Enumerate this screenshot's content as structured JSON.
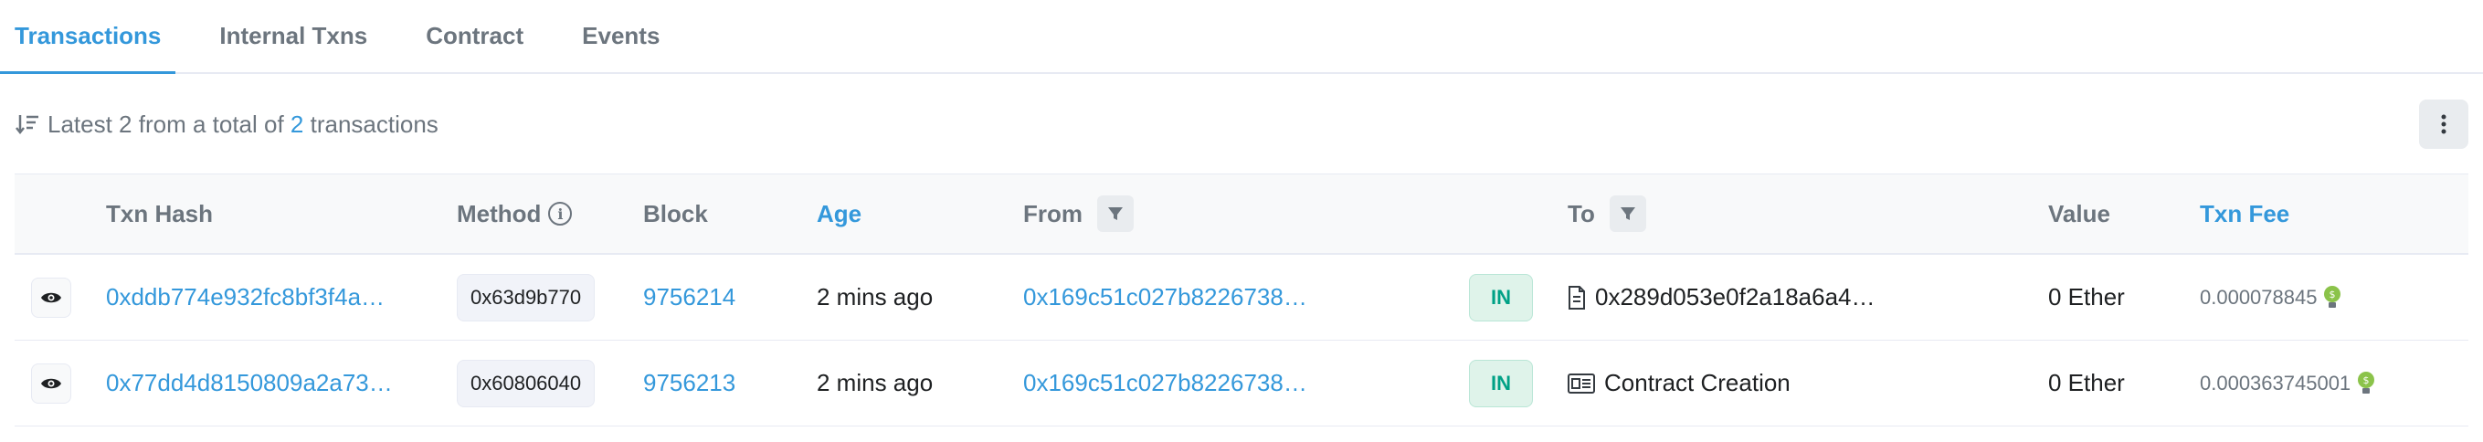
{
  "tabs": [
    {
      "label": "Transactions",
      "active": true
    },
    {
      "label": "Internal Txns",
      "active": false
    },
    {
      "label": "Contract",
      "active": false
    },
    {
      "label": "Events",
      "active": false
    }
  ],
  "summary": {
    "prefix": "Latest 2 from a total of ",
    "count": "2",
    "suffix": " transactions"
  },
  "columns": {
    "txn_hash": "Txn Hash",
    "method": "Method",
    "block": "Block",
    "age": "Age",
    "from": "From",
    "to": "To",
    "value": "Value",
    "txn_fee": "Txn Fee"
  },
  "rows": [
    {
      "hash": "0xddb774e932fc8bf3f4a…",
      "method": "0x63d9b770",
      "block": "9756214",
      "age": "2 mins ago",
      "from": "0x169c51c027b8226738…",
      "direction": "IN",
      "to_icon": "document-icon",
      "to": "0x289d053e0f2a18a6a4…",
      "value": "0 Ether",
      "fee": "0.000078845"
    },
    {
      "hash": "0x77dd4d8150809a2a73…",
      "method": "0x60806040",
      "block": "9756213",
      "age": "2 mins ago",
      "from": "0x169c51c027b8226738…",
      "direction": "IN",
      "to_icon": "contract-creation-icon",
      "to": "Contract Creation",
      "value": "0 Ether",
      "fee": "0.000363745001"
    }
  ],
  "colors": {
    "accent": "#3498db",
    "muted": "#6c757e",
    "in_badge_bg": "#dff3ea",
    "in_badge_text": "#00a186"
  }
}
